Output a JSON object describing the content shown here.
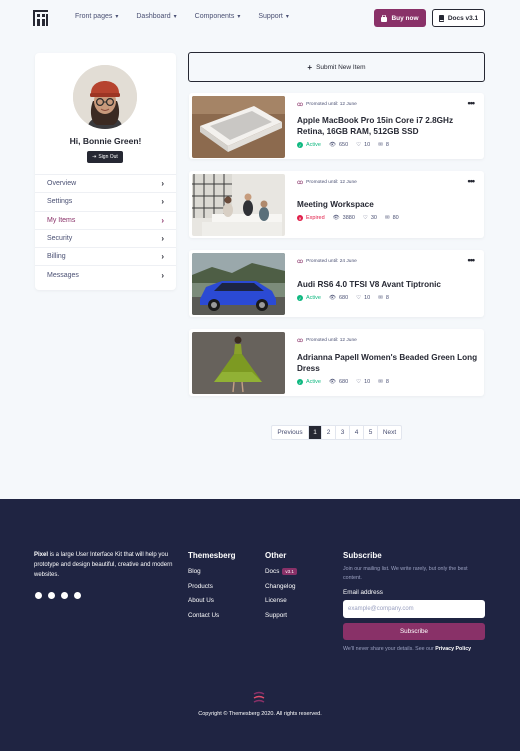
{
  "nav": {
    "items": [
      {
        "label": "Front pages"
      },
      {
        "label": "Dashboard"
      },
      {
        "label": "Components"
      },
      {
        "label": "Support"
      }
    ],
    "buy_label": "Buy now",
    "docs_label": "Docs v3.1"
  },
  "sidebar": {
    "greeting": "Hi, Bonnie Green!",
    "signout_label": "Sign Out",
    "items": [
      {
        "label": "Overview"
      },
      {
        "label": "Settings"
      },
      {
        "label": "My Items"
      },
      {
        "label": "Security"
      },
      {
        "label": "Billing"
      },
      {
        "label": "Messages"
      }
    ],
    "active_item": "My Items"
  },
  "main": {
    "submit_label": "Submit New Item",
    "items": [
      {
        "promo": "Promoted until: 12 June",
        "title": "Apple MacBook Pro 15in Core i7 2.8GHz Retina, 16GB RAM, 512GB SSD",
        "status": "Active",
        "views": "650",
        "likes": "10",
        "messages": "8"
      },
      {
        "promo": "Promoted until: 12 June",
        "title": "Meeting Workspace",
        "status": "Expired",
        "views": "3880",
        "likes": "30",
        "messages": "80"
      },
      {
        "promo": "Promoted until: 24 June",
        "title": "Audi RS6 4.0 TFSI V8 Avant Tiptronic",
        "status": "Active",
        "views": "680",
        "likes": "10",
        "messages": "8"
      },
      {
        "promo": "Promoted until: 12 June",
        "title": "Adrianna Papell Women's Beaded Green Long Dress",
        "status": "Active",
        "views": "680",
        "likes": "10",
        "messages": "8"
      }
    ]
  },
  "pagination": {
    "prev": "Previous",
    "pages": [
      "1",
      "2",
      "3",
      "4",
      "5"
    ],
    "current": "1",
    "next": "Next"
  },
  "footer": {
    "brand": "Pixel",
    "about_text": " is a large User Interface Kit that will help you prototype and design beautiful, creative and modern websites.",
    "col1": {
      "title": "Themesberg",
      "links": [
        "Blog",
        "Products",
        "About Us",
        "Contact Us"
      ]
    },
    "col2": {
      "title": "Other",
      "links": [
        "Docs",
        "Changelog",
        "License",
        "Support"
      ],
      "docs_badge": "v3.1"
    },
    "subscribe": {
      "title": "Subscribe",
      "text": "Join our mailing list. We write rarely, but only the best content.",
      "email_label": "Email address",
      "placeholder": "example@company.com",
      "button": "Subscribe",
      "note": "We'll never share your details. See our ",
      "policy": "Privacy Policy"
    },
    "copyright": "Copyright © Themesberg 2020. All rights reserved."
  },
  "colors": {
    "primary": "#893168",
    "dark": "#262833",
    "footer_bg": "#1f2442",
    "success": "#10b981",
    "danger": "#e11d48"
  }
}
